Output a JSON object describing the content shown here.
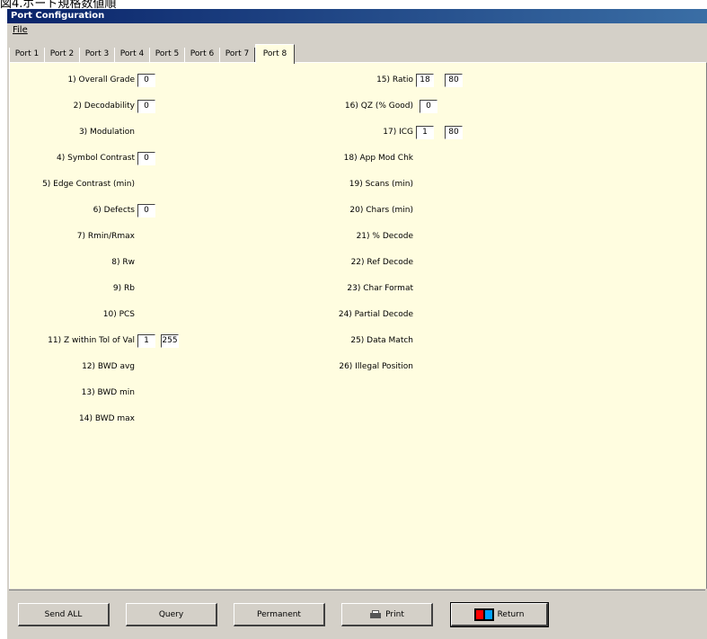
{
  "caption": "図4.ポート規格数値順",
  "window": {
    "title": "Port Configuration"
  },
  "menu": {
    "file": "File"
  },
  "tabs": [
    "Port 1",
    "Port 2",
    "Port 3",
    "Port 4",
    "Port 5",
    "Port 6",
    "Port 7",
    "Port 8"
  ],
  "active_tab": "Port 8",
  "left_params": [
    {
      "label": "1) Overall Grade",
      "v1": "0"
    },
    {
      "label": "2) Decodability",
      "v1": "0"
    },
    {
      "label": "3) Modulation"
    },
    {
      "label": "4) Symbol Contrast",
      "v1": "0"
    },
    {
      "label": "5) Edge Contrast (min)"
    },
    {
      "label": "6) Defects",
      "v1": "0"
    },
    {
      "label": "7) Rmin/Rmax"
    },
    {
      "label": "8) Rw"
    },
    {
      "label": "9) Rb"
    },
    {
      "label": "10) PCS"
    },
    {
      "label": "11) Z within Tol of Val",
      "v1": "1",
      "v2": "255"
    },
    {
      "label": "12) BWD avg"
    },
    {
      "label": "13) BWD min"
    },
    {
      "label": "14) BWD max"
    }
  ],
  "right_params": [
    {
      "label": "15) Ratio",
      "v1": "18",
      "v2": "80"
    },
    {
      "label": "16) QZ (% Good)",
      "v1": "0"
    },
    {
      "label": "17) ICG",
      "v1": "1",
      "v2": "80"
    },
    {
      "label": "18) App Mod Chk"
    },
    {
      "label": "19) Scans (min)"
    },
    {
      "label": "20) Chars (min)"
    },
    {
      "label": "21) % Decode"
    },
    {
      "label": "22) Ref Decode"
    },
    {
      "label": "23) Char Format"
    },
    {
      "label": "24) Partial Decode"
    },
    {
      "label": "25) Data Match"
    },
    {
      "label": "26) Illegal Position"
    }
  ],
  "buttons": {
    "send_all": "Send ALL",
    "query": "Query",
    "permanent": "Permanent",
    "print": "Print",
    "return": "Return"
  },
  "icons": {
    "print": "printer-icon",
    "return": "return-icon"
  }
}
